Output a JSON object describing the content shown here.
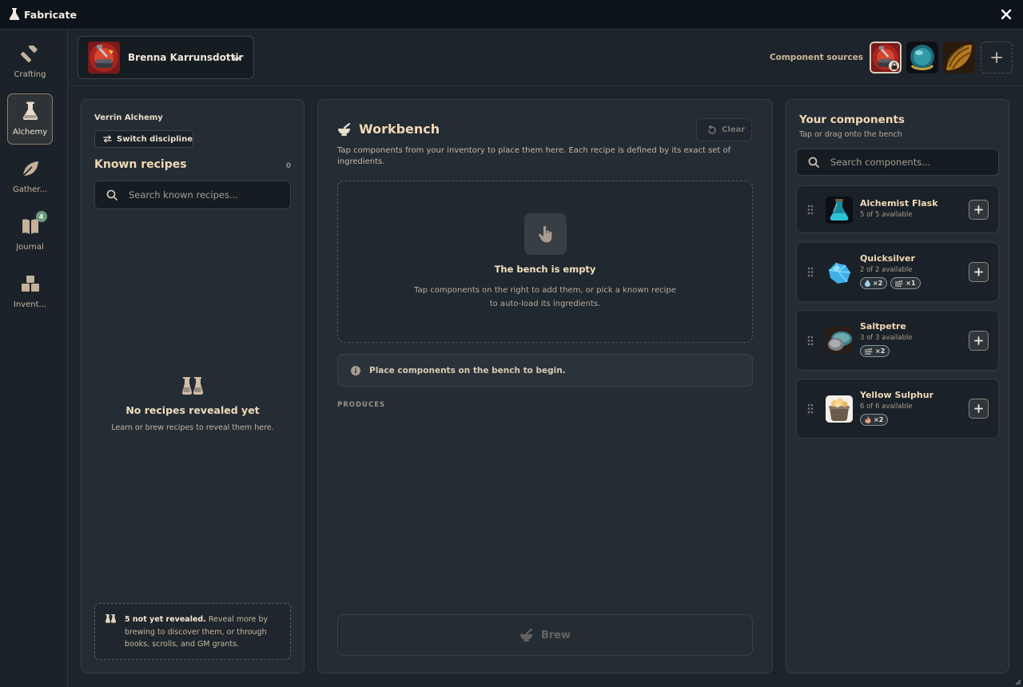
{
  "app": {
    "title": "Fabricate"
  },
  "nav": [
    {
      "label": "Crafting",
      "icon": "hammer-icon",
      "active": false
    },
    {
      "label": "Alchemy",
      "icon": "flask-icon",
      "active": true
    },
    {
      "label": "Gather...",
      "icon": "leaf-icon",
      "active": false
    },
    {
      "label": "Journal",
      "icon": "book-icon",
      "active": false,
      "badge": "4"
    },
    {
      "label": "Invent...",
      "icon": "boxes-icon",
      "active": false
    }
  ],
  "header": {
    "character": "Brenna Karrunsdottir",
    "sources_label": "Component sources"
  },
  "left": {
    "discipline": "Verrin Alchemy",
    "switch_label": "Switch discipline",
    "known_title": "Known recipes",
    "known_count": "0",
    "search_placeholder": "Search known recipes...",
    "empty_title": "No recipes revealed yet",
    "empty_sub": "Learn or brew recipes to reveal them here.",
    "hint_bold": "5 not yet revealed.",
    "hint_text": " Reveal more by brewing to discover them, or through books, scrolls, and GM grants."
  },
  "workbench": {
    "title": "Workbench",
    "clear_label": "Clear",
    "description": "Tap components from your inventory to place them here. Each recipe is defined by its exact set of ingredients.",
    "empty_title": "The bench is empty",
    "empty_sub": "Tap components on the right to add them, or pick a known recipe to auto-load its ingredients.",
    "status": "Place components on the bench to begin.",
    "produces_label": "PRODUCES",
    "brew_label": "Brew"
  },
  "components": {
    "title": "Your components",
    "subtitle": "Tap or drag onto the bench",
    "search_placeholder": "Search components...",
    "items": [
      {
        "name": "Alchemist Flask",
        "available": "5 of 5 available",
        "chips": []
      },
      {
        "name": "Quicksilver",
        "available": "2 of 2 available",
        "chips": [
          {
            "icon": "droplet-icon",
            "label": "×2"
          },
          {
            "icon": "wind-icon",
            "label": "×1"
          }
        ]
      },
      {
        "name": "Saltpetre",
        "available": "3 of 3 available",
        "chips": [
          {
            "icon": "wind-icon",
            "label": "×2"
          }
        ]
      },
      {
        "name": "Yellow Sulphur",
        "available": "6 of 6 available",
        "chips": [
          {
            "icon": "flame-icon",
            "label": "×2"
          }
        ]
      }
    ]
  },
  "colors": {
    "accent": "#f2d9b4",
    "panel": "#242c34",
    "background": "#1d242b",
    "badge": "#6a9b80"
  }
}
